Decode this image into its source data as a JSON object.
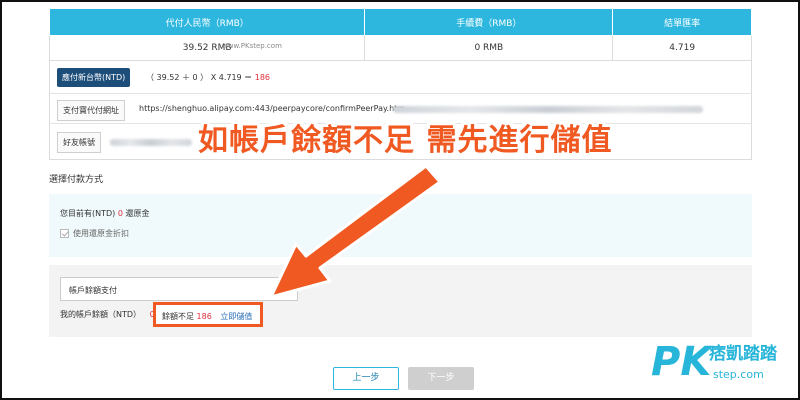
{
  "table": {
    "headers": [
      "代付人民幣（RMB）",
      "手續費（RMB）",
      "結單匯率"
    ],
    "values": [
      "39.52 RMB",
      "0 RMB",
      "4.719"
    ]
  },
  "watermark_mid": "www.PKstep.com",
  "payment": {
    "badge": "應付新台幣(NTD)",
    "formula_prefix": "（ 39.52 ＋ 0 ） X 4.719 ＝",
    "formula_total": "186"
  },
  "url_row": {
    "label": "支付寶代付網址",
    "url": "https://shenghuo.alipay.com:443/peerpaycore/confirmPeerPay.htm"
  },
  "friend_row": {
    "label": "好友帳號"
  },
  "annotation": "如帳戶餘額不足 需先進行儲值",
  "section_title": "選擇付款方式",
  "rebate": {
    "prefix": "您目前有(NTD)",
    "amount": "0",
    "suffix": "還原金",
    "checkbox_label": "使用還原金折扣"
  },
  "method": {
    "selected": "帳戶餘額支付",
    "balance_label": "我的帳戶餘額（NTD）",
    "balance_value": "0",
    "insufficient_label": "餘額不足",
    "insufficient_amount": "186",
    "topup_link": "立即儲值"
  },
  "buttons": {
    "prev": "上一步",
    "next": "下一步"
  },
  "logo": {
    "pk": "PK",
    "cn": "痞凱踏踏",
    "url": "step.com"
  },
  "colors": {
    "header": "#2db7df",
    "accent_red": "#e0303c",
    "annotation_orange": "#f05a22",
    "badge_navy": "#1d4e7a",
    "link_blue": "#2a6fb8"
  }
}
